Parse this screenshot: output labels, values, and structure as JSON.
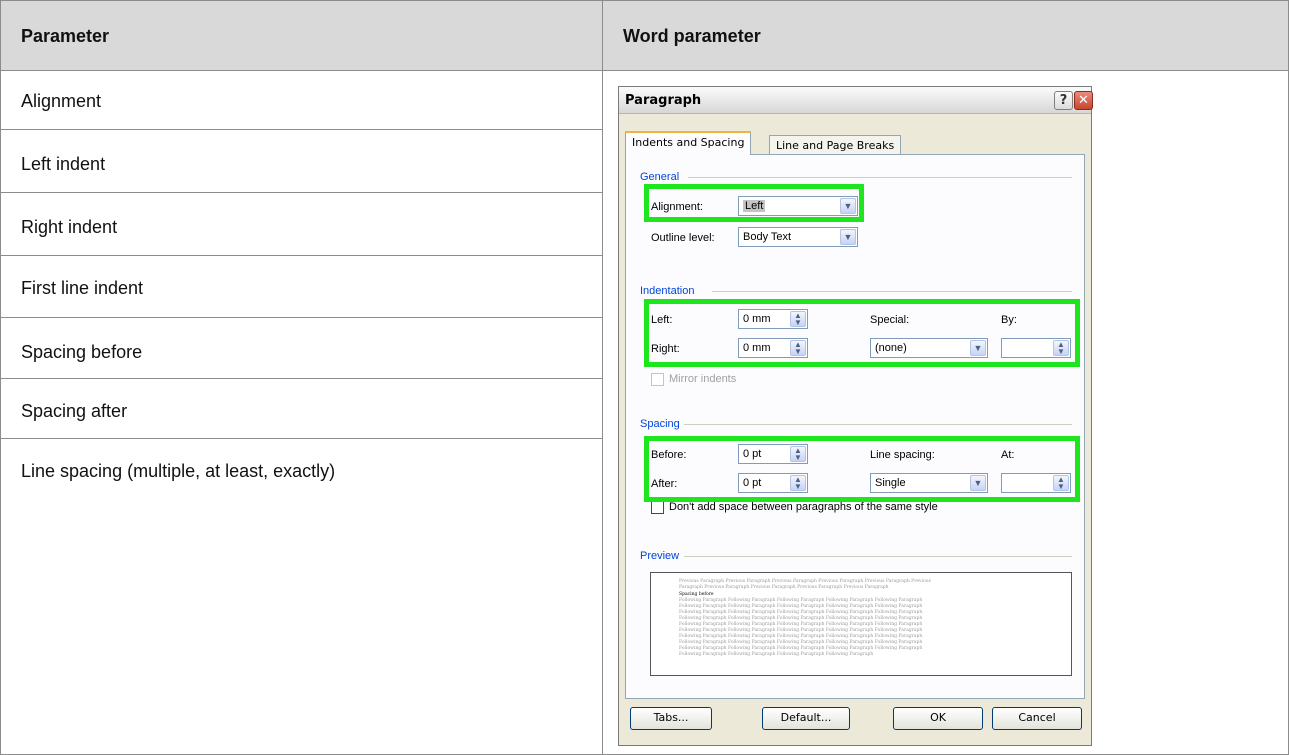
{
  "table": {
    "headers": [
      "Parameter",
      "Word parameter"
    ],
    "rows": [
      "Alignment",
      "Left indent",
      "Right indent",
      "First line indent",
      "Spacing before",
      "Spacing after",
      "Line spacing (multiple, at least, exactly)"
    ]
  },
  "dialog": {
    "title": "Paragraph",
    "help_glyph": "?",
    "close_glyph": "✕",
    "tabs": [
      "Indents and Spacing",
      "Line and Page Breaks"
    ],
    "general": {
      "heading": "General",
      "alignment_label": "Alignment:",
      "alignment_value": "Left",
      "outline_label": "Outline level:",
      "outline_value": "Body Text"
    },
    "indentation": {
      "heading": "Indentation",
      "left_label": "Left:",
      "left_value": "0 mm",
      "right_label": "Right:",
      "right_value": "0 mm",
      "special_label": "Special:",
      "special_value": "(none)",
      "by_label": "By:",
      "by_value": "",
      "mirror_label": "Mirror indents"
    },
    "spacing": {
      "heading": "Spacing",
      "before_label": "Before:",
      "before_value": "0 pt",
      "after_label": "After:",
      "after_value": "0 pt",
      "line_spacing_label": "Line spacing:",
      "line_spacing_value": "Single",
      "at_label": "At:",
      "at_value": "",
      "dont_add_label": "Don't add space between paragraphs of the same style"
    },
    "preview": {
      "heading": "Preview",
      "lines": [
        "Previous Paragraph Previous Paragraph Previous Paragraph Previous Paragraph Previous Paragraph Previous",
        "Paragraph Previous Paragraph Previous Paragraph Previous Paragraph Previous Paragraph",
        "Spacing before",
        "Following Paragraph Following Paragraph Following Paragraph Following Paragraph Following Paragraph",
        "Following Paragraph Following Paragraph Following Paragraph Following Paragraph Following Paragraph",
        "Following Paragraph Following Paragraph Following Paragraph Following Paragraph Following Paragraph",
        "Following Paragraph Following Paragraph Following Paragraph Following Paragraph Following Paragraph",
        "Following Paragraph Following Paragraph Following Paragraph Following Paragraph Following Paragraph",
        "Following Paragraph Following Paragraph Following Paragraph Following Paragraph Following Paragraph",
        "Following Paragraph Following Paragraph Following Paragraph Following Paragraph Following Paragraph",
        "Following Paragraph Following Paragraph Following Paragraph Following Paragraph Following Paragraph",
        "Following Paragraph Following Paragraph Following Paragraph Following Paragraph Following Paragraph",
        "Following Paragraph Following Paragraph Following Paragraph Following Paragraph"
      ]
    },
    "buttons": {
      "tabs": "Tabs...",
      "default": "Default...",
      "ok": "OK",
      "cancel": "Cancel"
    }
  },
  "colors": {
    "highlight": "#1ee61e",
    "header_bg": "#d9d9d9",
    "section_heading": "#0046d5"
  }
}
